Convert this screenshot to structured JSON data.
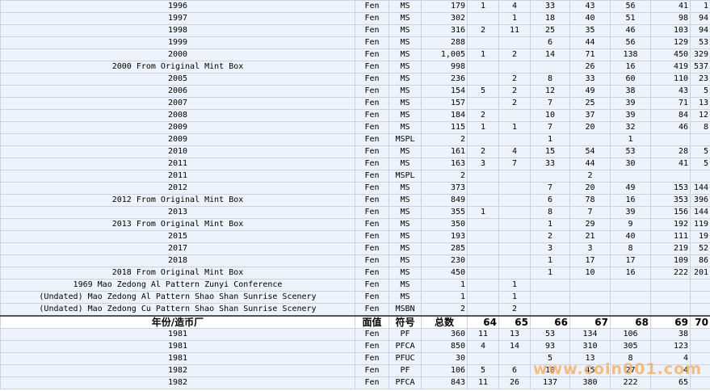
{
  "header": {
    "year": "年份/造币厂",
    "denom": "面值",
    "grade": "符号",
    "total": "总数",
    "c64": "64",
    "c65": "65",
    "c66": "66",
    "c67": "67",
    "c68": "68",
    "c69": "69",
    "c70": "70"
  },
  "rows_top": [
    {
      "year": "1996",
      "denom": "Fen",
      "grade": "MS",
      "total": "179",
      "c64": "1",
      "c65": "4",
      "c66": "33",
      "c67": "43",
      "c68": "56",
      "c69": "41",
      "c70": "1"
    },
    {
      "year": "1997",
      "denom": "Fen",
      "grade": "MS",
      "total": "302",
      "c64": "",
      "c65": "1",
      "c66": "18",
      "c67": "40",
      "c68": "51",
      "c69": "98",
      "c70": "94"
    },
    {
      "year": "1998",
      "denom": "Fen",
      "grade": "MS",
      "total": "316",
      "c64": "2",
      "c65": "11",
      "c66": "25",
      "c67": "35",
      "c68": "46",
      "c69": "103",
      "c70": "94"
    },
    {
      "year": "1999",
      "denom": "Fen",
      "grade": "MS",
      "total": "288",
      "c64": "",
      "c65": "",
      "c66": "6",
      "c67": "44",
      "c68": "56",
      "c69": "129",
      "c70": "53"
    },
    {
      "year": "2000",
      "denom": "Fen",
      "grade": "MS",
      "total": "1,005",
      "c64": "1",
      "c65": "2",
      "c66": "14",
      "c67": "71",
      "c68": "138",
      "c69": "450",
      "c70": "329"
    },
    {
      "year": "2000 From Original Mint Box",
      "denom": "Fen",
      "grade": "MS",
      "total": "998",
      "c64": "",
      "c65": "",
      "c66": "",
      "c67": "26",
      "c68": "16",
      "c69": "419",
      "c70": "537"
    },
    {
      "year": "2005",
      "denom": "Fen",
      "grade": "MS",
      "total": "236",
      "c64": "",
      "c65": "2",
      "c66": "8",
      "c67": "33",
      "c68": "60",
      "c69": "110",
      "c70": "23"
    },
    {
      "year": "2006",
      "denom": "Fen",
      "grade": "MS",
      "total": "154",
      "c64": "5",
      "c65": "2",
      "c66": "12",
      "c67": "49",
      "c68": "38",
      "c69": "43",
      "c70": "5"
    },
    {
      "year": "2007",
      "denom": "Fen",
      "grade": "MS",
      "total": "157",
      "c64": "",
      "c65": "2",
      "c66": "7",
      "c67": "25",
      "c68": "39",
      "c69": "71",
      "c70": "13"
    },
    {
      "year": "2008",
      "denom": "Fen",
      "grade": "MS",
      "total": "184",
      "c64": "2",
      "c65": "",
      "c66": "10",
      "c67": "37",
      "c68": "39",
      "c69": "84",
      "c70": "12"
    },
    {
      "year": "2009",
      "denom": "Fen",
      "grade": "MS",
      "total": "115",
      "c64": "1",
      "c65": "1",
      "c66": "7",
      "c67": "20",
      "c68": "32",
      "c69": "46",
      "c70": "8"
    },
    {
      "year": "2009",
      "denom": "Fen",
      "grade": "MSPL",
      "total": "2",
      "c64": "",
      "c65": "",
      "c66": "1",
      "c67": "",
      "c68": "1",
      "c69": "",
      "c70": ""
    },
    {
      "year": "2010",
      "denom": "Fen",
      "grade": "MS",
      "total": "161",
      "c64": "2",
      "c65": "4",
      "c66": "15",
      "c67": "54",
      "c68": "53",
      "c69": "28",
      "c70": "5"
    },
    {
      "year": "2011",
      "denom": "Fen",
      "grade": "MS",
      "total": "163",
      "c64": "3",
      "c65": "7",
      "c66": "33",
      "c67": "44",
      "c68": "30",
      "c69": "41",
      "c70": "5"
    },
    {
      "year": "2011",
      "denom": "Fen",
      "grade": "MSPL",
      "total": "2",
      "c64": "",
      "c65": "",
      "c66": "",
      "c67": "2",
      "c68": "",
      "c69": "",
      "c70": ""
    },
    {
      "year": "2012",
      "denom": "Fen",
      "grade": "MS",
      "total": "373",
      "c64": "",
      "c65": "",
      "c66": "7",
      "c67": "20",
      "c68": "49",
      "c69": "153",
      "c70": "144"
    },
    {
      "year": "2012 From Original Mint Box",
      "denom": "Fen",
      "grade": "MS",
      "total": "849",
      "c64": "",
      "c65": "",
      "c66": "6",
      "c67": "78",
      "c68": "16",
      "c69": "353",
      "c70": "396"
    },
    {
      "year": "2013",
      "denom": "Fen",
      "grade": "MS",
      "total": "355",
      "c64": "1",
      "c65": "",
      "c66": "8",
      "c67": "7",
      "c68": "39",
      "c69": "156",
      "c70": "144"
    },
    {
      "year": "2013 From Original Mint Box",
      "denom": "Fen",
      "grade": "MS",
      "total": "350",
      "c64": "",
      "c65": "",
      "c66": "1",
      "c67": "29",
      "c68": "9",
      "c69": "192",
      "c70": "119"
    },
    {
      "year": "2015",
      "denom": "Fen",
      "grade": "MS",
      "total": "193",
      "c64": "",
      "c65": "",
      "c66": "2",
      "c67": "21",
      "c68": "40",
      "c69": "111",
      "c70": "19"
    },
    {
      "year": "2017",
      "denom": "Fen",
      "grade": "MS",
      "total": "285",
      "c64": "",
      "c65": "",
      "c66": "3",
      "c67": "3",
      "c68": "8",
      "c69": "219",
      "c70": "52"
    },
    {
      "year": "2018",
      "denom": "Fen",
      "grade": "MS",
      "total": "230",
      "c64": "",
      "c65": "",
      "c66": "1",
      "c67": "17",
      "c68": "17",
      "c69": "109",
      "c70": "86"
    },
    {
      "year": "2018 From Original Mint Box",
      "denom": "Fen",
      "grade": "MS",
      "total": "450",
      "c64": "",
      "c65": "",
      "c66": "1",
      "c67": "10",
      "c68": "16",
      "c69": "222",
      "c70": "201"
    },
    {
      "year": "1969 Mao Zedong Al Pattern Zunyi Conference",
      "denom": "Fen",
      "grade": "MS",
      "total": "1",
      "c64": "",
      "c65": "1",
      "c66": "",
      "c67": "",
      "c68": "",
      "c69": "",
      "c70": ""
    },
    {
      "year": "(Undated) Mao Zedong Al Pattern Shao Shan Sunrise Scenery",
      "denom": "Fen",
      "grade": "MS",
      "total": "1",
      "c64": "",
      "c65": "1",
      "c66": "",
      "c67": "",
      "c68": "",
      "c69": "",
      "c70": ""
    },
    {
      "year": "(Undated) Mao Zedong Cu Pattern Shao Shan Sunrise Scenery",
      "denom": "Fen",
      "grade": "MSBN",
      "total": "2",
      "c64": "",
      "c65": "2",
      "c66": "",
      "c67": "",
      "c68": "",
      "c69": "",
      "c70": ""
    }
  ],
  "rows_bottom": [
    {
      "year": "1981",
      "denom": "Fen",
      "grade": "PF",
      "total": "360",
      "c64": "11",
      "c65": "13",
      "c66": "53",
      "c67": "134",
      "c68": "106",
      "c69": "38",
      "c70": ""
    },
    {
      "year": "1981",
      "denom": "Fen",
      "grade": "PFCA",
      "total": "850",
      "c64": "4",
      "c65": "14",
      "c66": "93",
      "c67": "310",
      "c68": "305",
      "c69": "123",
      "c70": ""
    },
    {
      "year": "1981",
      "denom": "Fen",
      "grade": "PFUC",
      "total": "30",
      "c64": "",
      "c65": "",
      "c66": "5",
      "c67": "13",
      "c68": "8",
      "c69": "4",
      "c70": ""
    },
    {
      "year": "1982",
      "denom": "Fen",
      "grade": "PF",
      "total": "106",
      "c64": "5",
      "c65": "6",
      "c66": "18",
      "c67": "45",
      "c68": "27",
      "c69": "4",
      "c70": ""
    },
    {
      "year": "1982",
      "denom": "Fen",
      "grade": "PFCA",
      "total": "843",
      "c64": "11",
      "c65": "26",
      "c66": "137",
      "c67": "380",
      "c68": "222",
      "c69": "65",
      "c70": ""
    }
  ],
  "watermark": "www.coin001.com"
}
